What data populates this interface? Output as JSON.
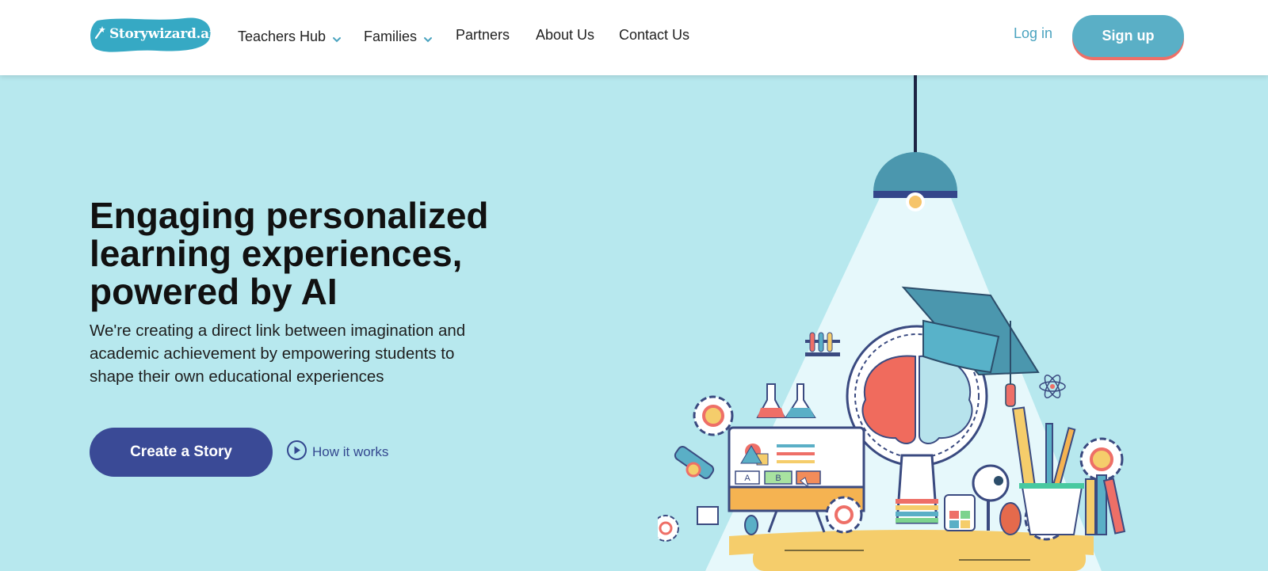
{
  "logo": {
    "text": "Storywizard.ai",
    "icon": "magic-wand-icon"
  },
  "nav": {
    "items": [
      {
        "label": "Teachers Hub",
        "has_dropdown": true
      },
      {
        "label": "Families",
        "has_dropdown": true
      },
      {
        "label": "Partners",
        "has_dropdown": false
      },
      {
        "label": "About Us",
        "has_dropdown": false
      },
      {
        "label": "Contact Us",
        "has_dropdown": false
      }
    ],
    "login_label": "Log in",
    "signup_label": "Sign up"
  },
  "hero": {
    "title": "Engaging personalized learning experiences, powered by AI",
    "subtitle": "We're creating a direct link between imagination and academic achievement by empowering students to shape their own educational experiences",
    "cta_label": "Create a Story",
    "how_label": "How it works",
    "illustration_labels": {
      "box_a": "A",
      "box_b": "B"
    }
  },
  "colors": {
    "background": "#b7e8ee",
    "brand": "#5aafc6",
    "cta": "#3a4a96",
    "accent_red": "#ee6f67"
  }
}
